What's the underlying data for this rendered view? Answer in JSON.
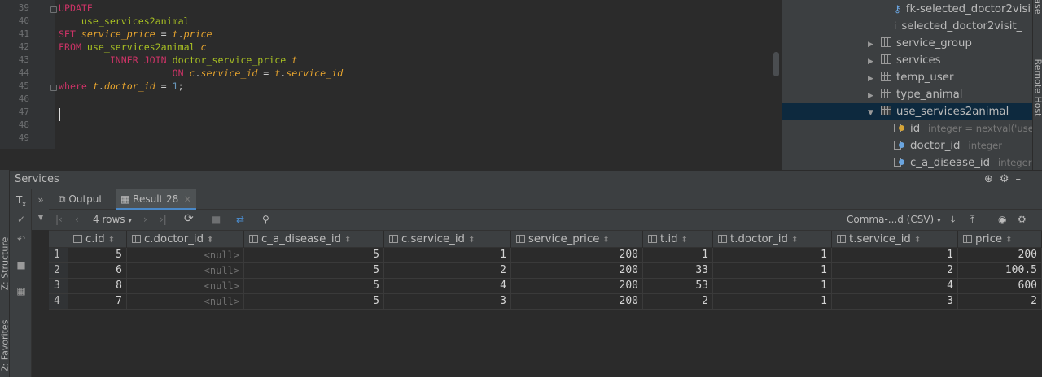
{
  "editor": {
    "line_numbers": [
      "39",
      "40",
      "41",
      "42",
      "43",
      "44",
      "45",
      "46",
      "47",
      "48",
      "49"
    ],
    "lines": [
      [
        {
          "t": "UPDATE",
          "c": "kw"
        }
      ],
      [
        {
          "t": "    use_services2animal",
          "c": "tb"
        }
      ],
      [
        {
          "t": "SET ",
          "c": "kw"
        },
        {
          "t": "service_price",
          "c": "al"
        },
        {
          "t": " = ",
          "c": "op"
        },
        {
          "t": "t",
          "c": "al"
        },
        {
          "t": ".",
          "c": "op"
        },
        {
          "t": "price",
          "c": "al"
        }
      ],
      [
        {
          "t": "FROM ",
          "c": "kw"
        },
        {
          "t": "use_services2animal ",
          "c": "tb"
        },
        {
          "t": "c",
          "c": "al"
        }
      ],
      [
        {
          "t": "         INNER JOIN ",
          "c": "kw"
        },
        {
          "t": "doctor_service_price ",
          "c": "tb"
        },
        {
          "t": "t",
          "c": "al"
        }
      ],
      [
        {
          "t": "                    ON ",
          "c": "kw"
        },
        {
          "t": "c",
          "c": "al"
        },
        {
          "t": ".",
          "c": "op"
        },
        {
          "t": "service_id",
          "c": "al"
        },
        {
          "t": " = ",
          "c": "op"
        },
        {
          "t": "t",
          "c": "al"
        },
        {
          "t": ".",
          "c": "op"
        },
        {
          "t": "service_id",
          "c": "al"
        }
      ],
      [
        {
          "t": "where ",
          "c": "kw"
        },
        {
          "t": "t",
          "c": "al"
        },
        {
          "t": ".",
          "c": "op"
        },
        {
          "t": "doctor_id",
          "c": "al"
        },
        {
          "t": " = ",
          "c": "op"
        },
        {
          "t": "1",
          "c": "nm"
        },
        {
          "t": ";",
          "c": "op"
        }
      ],
      [],
      [],
      [],
      []
    ]
  },
  "db_tree": {
    "fk_item": "fk-selected_doctor2visi",
    "idx_item": "selected_doctor2visit_",
    "tables": [
      "service_group",
      "services",
      "temp_user",
      "type_animal"
    ],
    "expanded_table": "use_services2animal",
    "columns": [
      {
        "name": "id",
        "type": "integer = nextval('use_"
      },
      {
        "name": "doctor_id",
        "type": "integer"
      },
      {
        "name": "c_a_disease_id",
        "type": "integer"
      }
    ]
  },
  "right_stripe": {
    "top": "abase",
    "bottom": "Remote Host"
  },
  "left_stripe": {
    "top": "Z: Structure",
    "bottom": "2: Favorites"
  },
  "services": {
    "title": "Services",
    "tabs": [
      {
        "label": "Output"
      },
      {
        "label": "Result 28"
      }
    ],
    "rows_label": "4 rows",
    "export_format": "Comma-...d (CSV)"
  },
  "result": {
    "columns": [
      "c.id",
      "c.doctor_id",
      "c_a_disease_id",
      "c.service_id",
      "service_price",
      "t.id",
      "t.doctor_id",
      "t.service_id",
      "price"
    ],
    "rows": [
      [
        "1",
        "5",
        "<null>",
        "5",
        "1",
        "200",
        "1",
        "1",
        "1",
        "200"
      ],
      [
        "2",
        "6",
        "<null>",
        "5",
        "2",
        "200",
        "33",
        "1",
        "2",
        "100.5"
      ],
      [
        "3",
        "8",
        "<null>",
        "5",
        "4",
        "200",
        "53",
        "1",
        "4",
        "600"
      ],
      [
        "4",
        "7",
        "<null>",
        "5",
        "3",
        "200",
        "2",
        "1",
        "3",
        "2"
      ]
    ]
  }
}
